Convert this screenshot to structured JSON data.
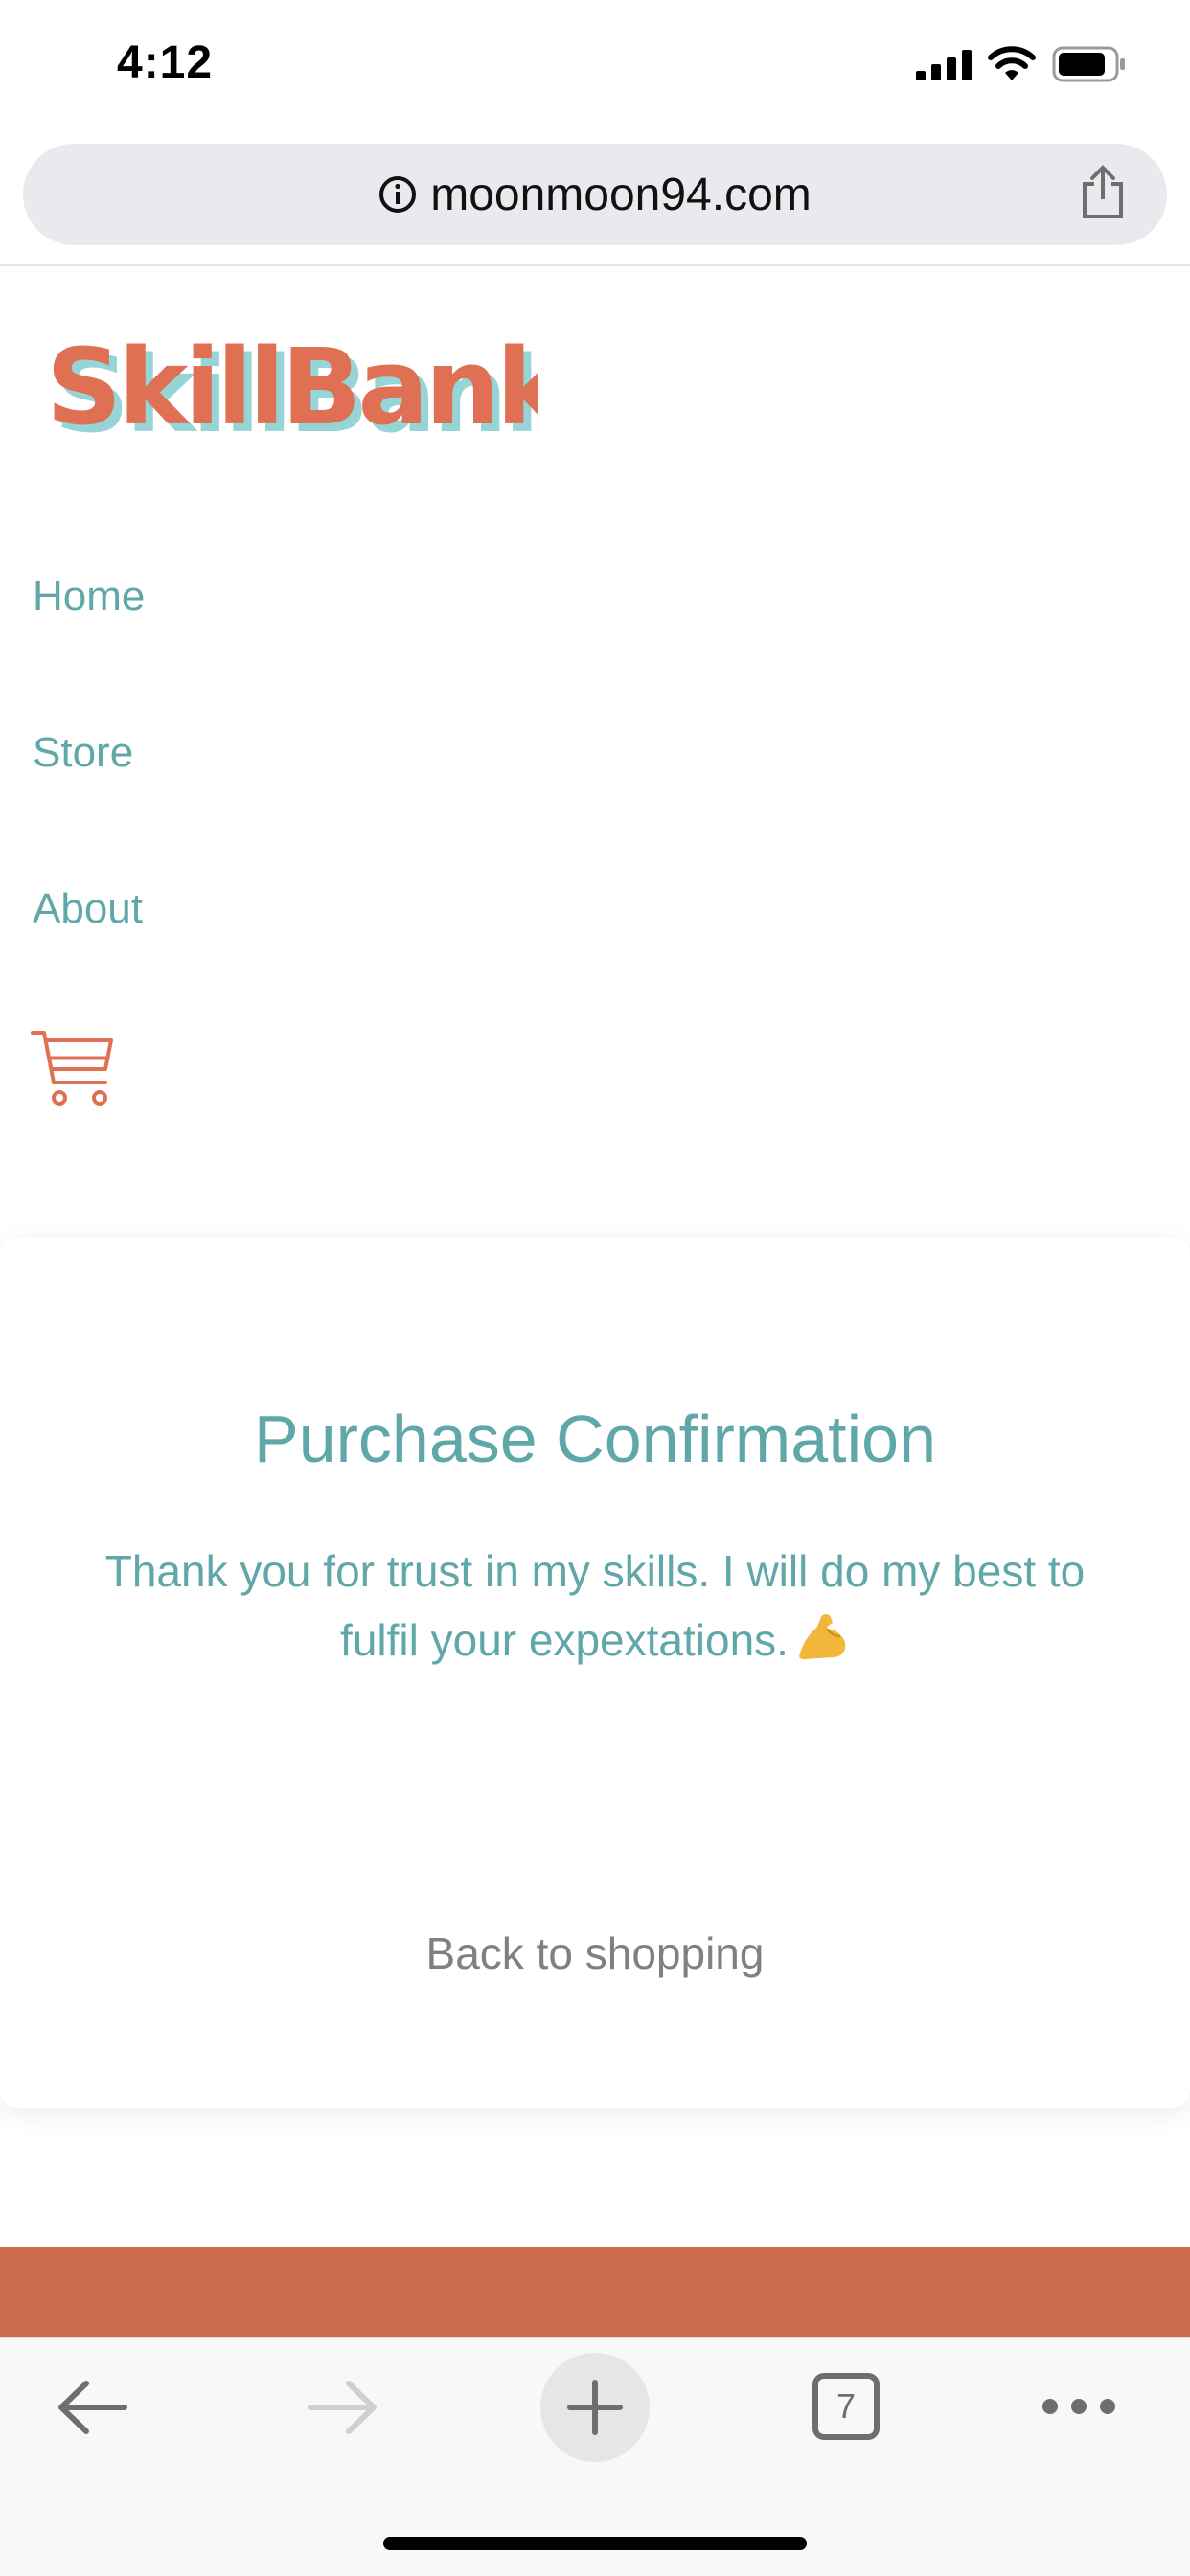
{
  "status_bar": {
    "time": "4:12"
  },
  "browser": {
    "url": "moonmoon94.com",
    "tab_count": "7"
  },
  "site": {
    "logo_text": "SkillBank",
    "nav": {
      "home": "Home",
      "store": "Store",
      "about": "About"
    }
  },
  "confirmation": {
    "title": "Purchase Confirmation",
    "message": "Thank you for trust in my skills. I will do my best to fulfil your expextations.",
    "back_label": "Back to shopping"
  },
  "icons": {
    "info": "info-icon",
    "share": "share-icon",
    "cart": "shopping-cart-icon",
    "muscle": "flexed-biceps-emoji",
    "back": "arrow-left-icon",
    "forward": "arrow-right-icon",
    "new_tab": "plus-icon",
    "more": "ellipsis-icon"
  },
  "colors": {
    "accent": "#5fa7a8",
    "brand_coral": "#e07054",
    "footer": "#cd6b4f",
    "muted_text": "#808080"
  }
}
